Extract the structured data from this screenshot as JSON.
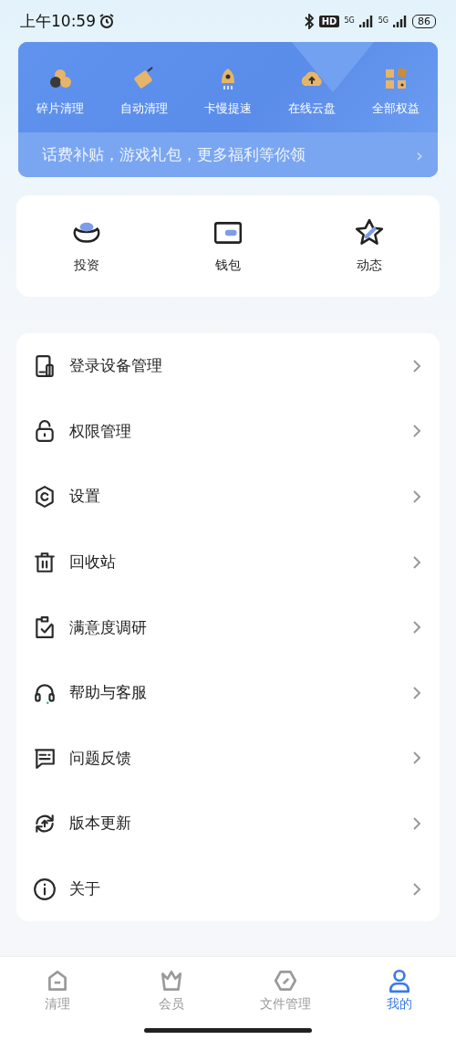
{
  "status_bar": {
    "time": "上午10:59",
    "hd": "HD",
    "network_1": "5G",
    "network_2": "5G",
    "battery": "86"
  },
  "benefits": {
    "items": [
      {
        "label": "碎片清理"
      },
      {
        "label": "自动清理"
      },
      {
        "label": "卡慢提速"
      },
      {
        "label": "在线云盘"
      },
      {
        "label": "全部权益"
      }
    ],
    "banner": "话费补贴，游戏礼包，更多福利等你领",
    "banner_arrow": "›"
  },
  "shortcuts": [
    {
      "label": "投资"
    },
    {
      "label": "钱包"
    },
    {
      "label": "动态"
    }
  ],
  "menu": [
    {
      "label": "登录设备管理"
    },
    {
      "label": "权限管理"
    },
    {
      "label": "设置"
    },
    {
      "label": "回收站"
    },
    {
      "label": "满意度调研"
    },
    {
      "label": "帮助与客服"
    },
    {
      "label": "问题反馈"
    },
    {
      "label": "版本更新"
    },
    {
      "label": "关于"
    }
  ],
  "tab_bar": [
    {
      "label": "清理",
      "selected": false
    },
    {
      "label": "会员",
      "selected": false
    },
    {
      "label": "文件管理",
      "selected": false
    },
    {
      "label": "我的",
      "selected": true
    }
  ]
}
